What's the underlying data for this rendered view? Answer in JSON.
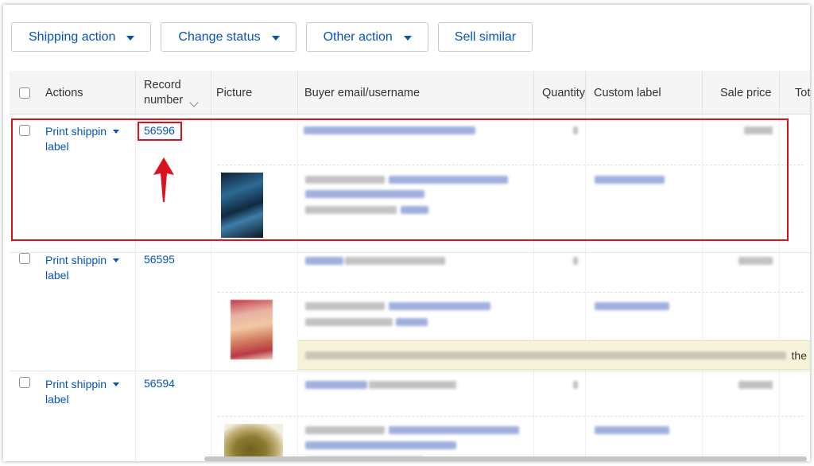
{
  "toolbar": {
    "shipping_action": "Shipping action",
    "change_status": "Change status",
    "other_action": "Other action",
    "sell_similar": "Sell similar"
  },
  "table": {
    "headers": {
      "actions": "Actions",
      "record_number_line1": "Record",
      "record_number_line2": "number",
      "picture": "Picture",
      "buyer": "Buyer email/username",
      "quantity": "Quantity",
      "custom_label": "Custom label",
      "sale_price": "Sale price",
      "total": "Tot"
    },
    "rows": [
      {
        "action_line1": "Print shippin",
        "action_line2": "label",
        "record": "56596"
      },
      {
        "action_line1": "Print shippin",
        "action_line2": "label",
        "record": "56595"
      },
      {
        "action_line1": "Print shippin",
        "action_line2": "label",
        "record": "56594"
      }
    ],
    "notice_tail": "the"
  },
  "icons": {
    "dropdown": "chevron-down-icon",
    "sort": "sort-chevron-icon",
    "annotation_arrow": "arrow-up-icon"
  },
  "colors": {
    "link_blue": "#0654ba",
    "annotation_red": "#d9121e",
    "header_bg": "#f5f5f5",
    "notice_bg": "#f7f3d9"
  }
}
